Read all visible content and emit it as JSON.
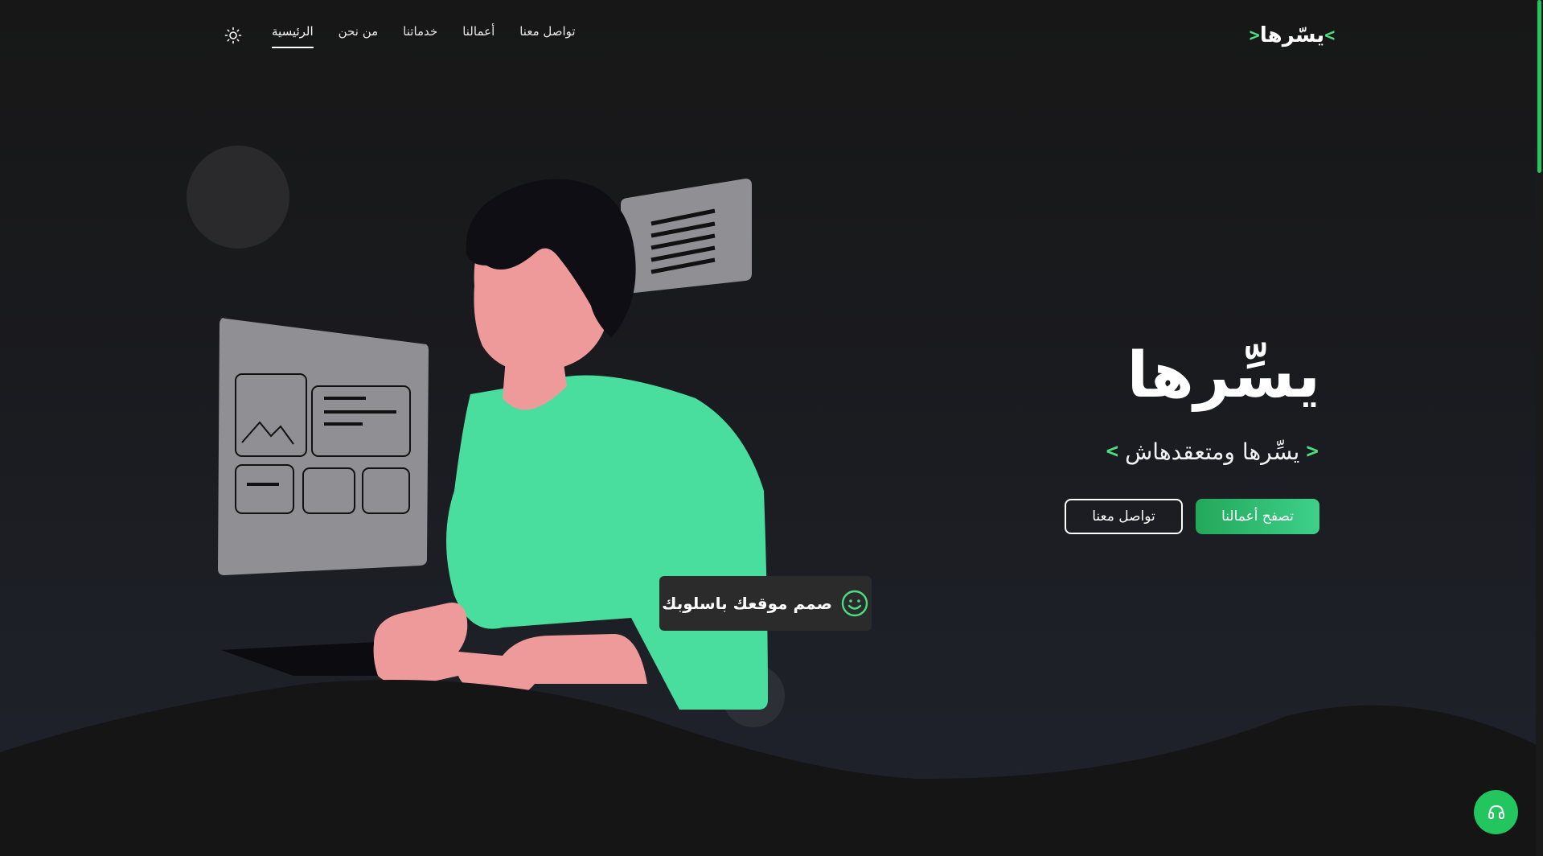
{
  "brand": {
    "logo_text": "يسّرها",
    "logo_left_bracket": "<",
    "logo_right_bracket": ">",
    "accent_color": "#4ade80"
  },
  "nav": {
    "items": [
      {
        "label": "الرئيسية",
        "active": true
      },
      {
        "label": "من نحن",
        "active": false
      },
      {
        "label": "خدماتنا",
        "active": false
      },
      {
        "label": "أعمالنا",
        "active": false
      },
      {
        "label": "تواصل معنا",
        "active": false
      }
    ],
    "theme_toggle_icon": "sun-icon"
  },
  "hero": {
    "title": "يسِّرها",
    "subtitle": "يسِّرها ومتعقدهاش",
    "subtitle_left_chevron": "<",
    "subtitle_right_chevron": ">",
    "primary_button": "تصفح أعمالنا",
    "secondary_button": "تواصل معنا"
  },
  "illustration": {
    "badge_text": "صمم موقعك باسلوبك",
    "badge_icon": "smile-icon",
    "colors": {
      "skin": "#ee9a9a",
      "shirt": "#4ade9e",
      "hair": "#0e0e14",
      "panel": "#8f8f94"
    }
  },
  "support": {
    "icon": "headset-icon",
    "color": "#22c55e"
  }
}
